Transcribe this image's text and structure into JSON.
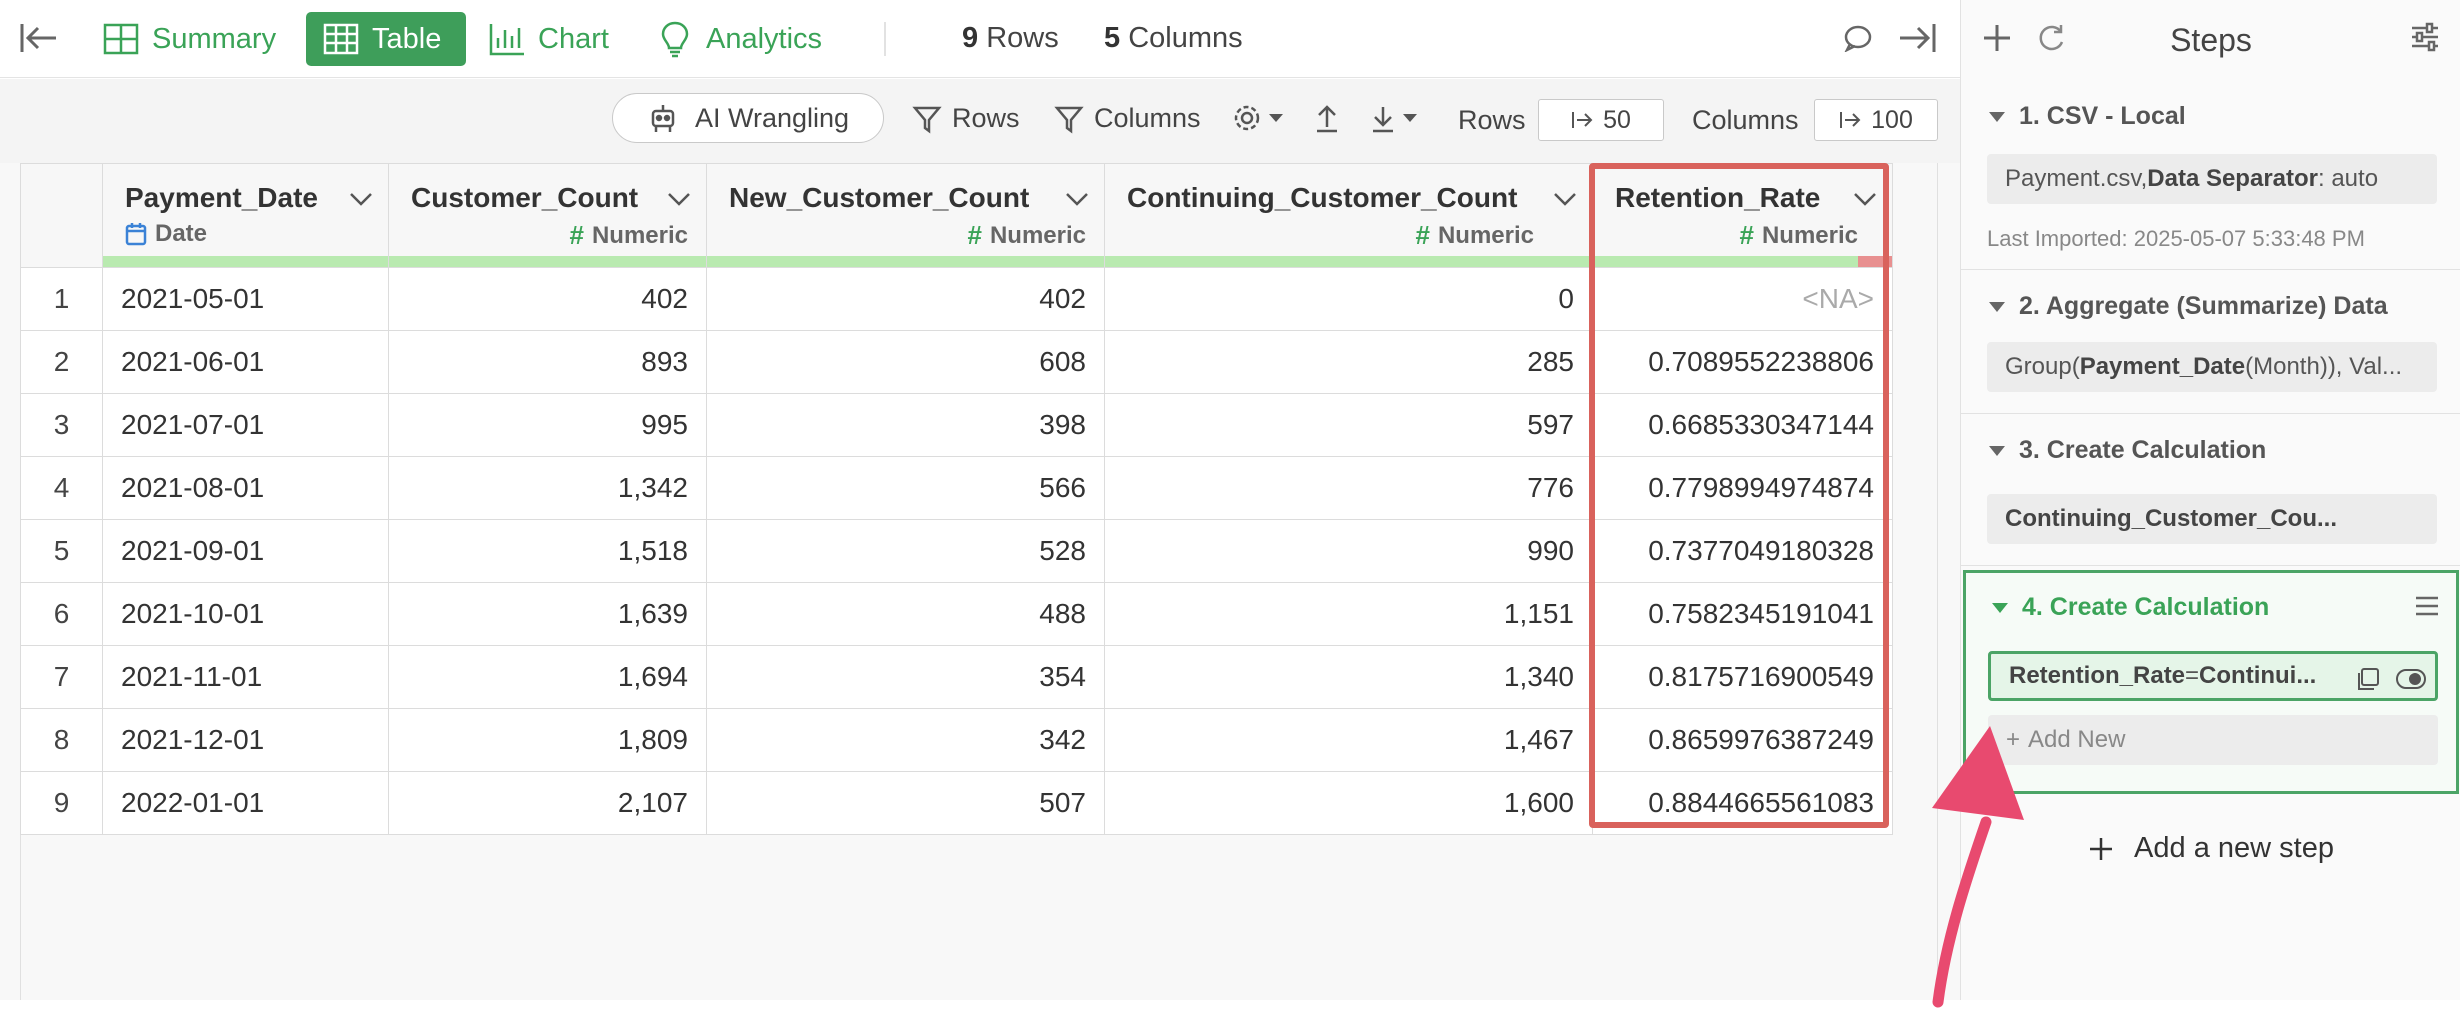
{
  "topbar": {
    "tabs": [
      {
        "label": "Summary",
        "icon": "summary-grid-icon"
      },
      {
        "label": "Table",
        "icon": "table-icon"
      },
      {
        "label": "Chart",
        "icon": "bar-chart-icon"
      },
      {
        "label": "Analytics",
        "icon": "lightbulb-icon"
      }
    ],
    "rows_count": "9",
    "rows_label": "Rows",
    "cols_count": "5",
    "cols_label": "Columns"
  },
  "toolbar": {
    "ai_label": "AI Wrangling",
    "rows_filter": "Rows",
    "cols_filter": "Columns",
    "rows_label": "Rows",
    "rows_value": "50",
    "cols_label": "Columns",
    "cols_value": "100"
  },
  "table": {
    "columns": [
      {
        "name": "Payment_Date",
        "type": "Date"
      },
      {
        "name": "Customer_Count",
        "type": "Numeric"
      },
      {
        "name": "New_Customer_Count",
        "type": "Numeric"
      },
      {
        "name": "Continuing_Customer_Count",
        "type": "Numeric"
      },
      {
        "name": "Retention_Rate",
        "type": "Numeric"
      }
    ],
    "rows": [
      [
        "1",
        "2021-05-01",
        "402",
        "402",
        "0",
        "<NA>"
      ],
      [
        "2",
        "2021-06-01",
        "893",
        "608",
        "285",
        "0.7089552238806"
      ],
      [
        "3",
        "2021-07-01",
        "995",
        "398",
        "597",
        "0.6685330347144"
      ],
      [
        "4",
        "2021-08-01",
        "1,342",
        "566",
        "776",
        "0.7798994974874"
      ],
      [
        "5",
        "2021-09-01",
        "1,518",
        "528",
        "990",
        "0.7377049180328"
      ],
      [
        "6",
        "2021-10-01",
        "1,639",
        "488",
        "1,151",
        "0.7582345191041"
      ],
      [
        "7",
        "2021-11-01",
        "1,694",
        "354",
        "1,340",
        "0.8175716900549"
      ],
      [
        "8",
        "2021-12-01",
        "1,809",
        "342",
        "1,467",
        "0.8659976387249"
      ],
      [
        "9",
        "2022-01-01",
        "2,107",
        "507",
        "1,600",
        "0.8844665561083"
      ]
    ]
  },
  "steps": {
    "title": "Steps",
    "items": [
      {
        "title": "1. CSV - Local",
        "box_pre": "Payment.csv, ",
        "box_bold": "Data Separator",
        "box_post": ": auto",
        "note": "Last Imported: 2025-05-07 5:33:48 PM"
      },
      {
        "title": "2. Aggregate (Summarize) Data",
        "box_pre": "Group(",
        "box_bold": "Payment_Date",
        "box_post": " (Month)), Val..."
      },
      {
        "title": "3. Create Calculation",
        "box_bold": "Continuing_Customer_Cou..."
      },
      {
        "title": "4. Create Calculation",
        "box_bold": "Retention_Rate",
        "box_mid": " = ",
        "box_bold2": "Continui...",
        "add_new": "Add New"
      }
    ],
    "add_step": "Add a new step"
  },
  "colors": {
    "accent": "#3e9e5a",
    "highlight": "#d9625c",
    "arrow": "#e84a6f"
  }
}
